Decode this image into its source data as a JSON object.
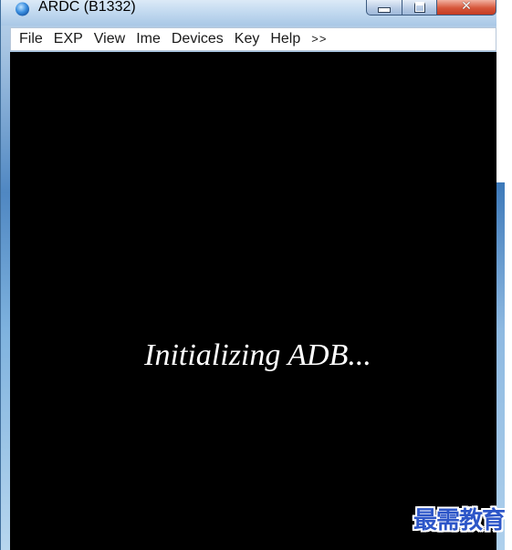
{
  "window": {
    "title": "ARDC (B1332)",
    "controls": {
      "minimize": "minimize-icon",
      "maximize": "maximize-icon",
      "close": "close-icon"
    }
  },
  "menu": {
    "items": [
      "File",
      "EXP",
      "View",
      "Ime",
      "Devices",
      "Key",
      "Help",
      ">>"
    ]
  },
  "screen": {
    "status": "Initializing ADB..."
  },
  "watermark": "最需教育",
  "colors": {
    "screen_bg": "#000000",
    "title_bar": "#c6dcf1",
    "close_button": "#d6563a",
    "watermark": "#2d56c8"
  }
}
